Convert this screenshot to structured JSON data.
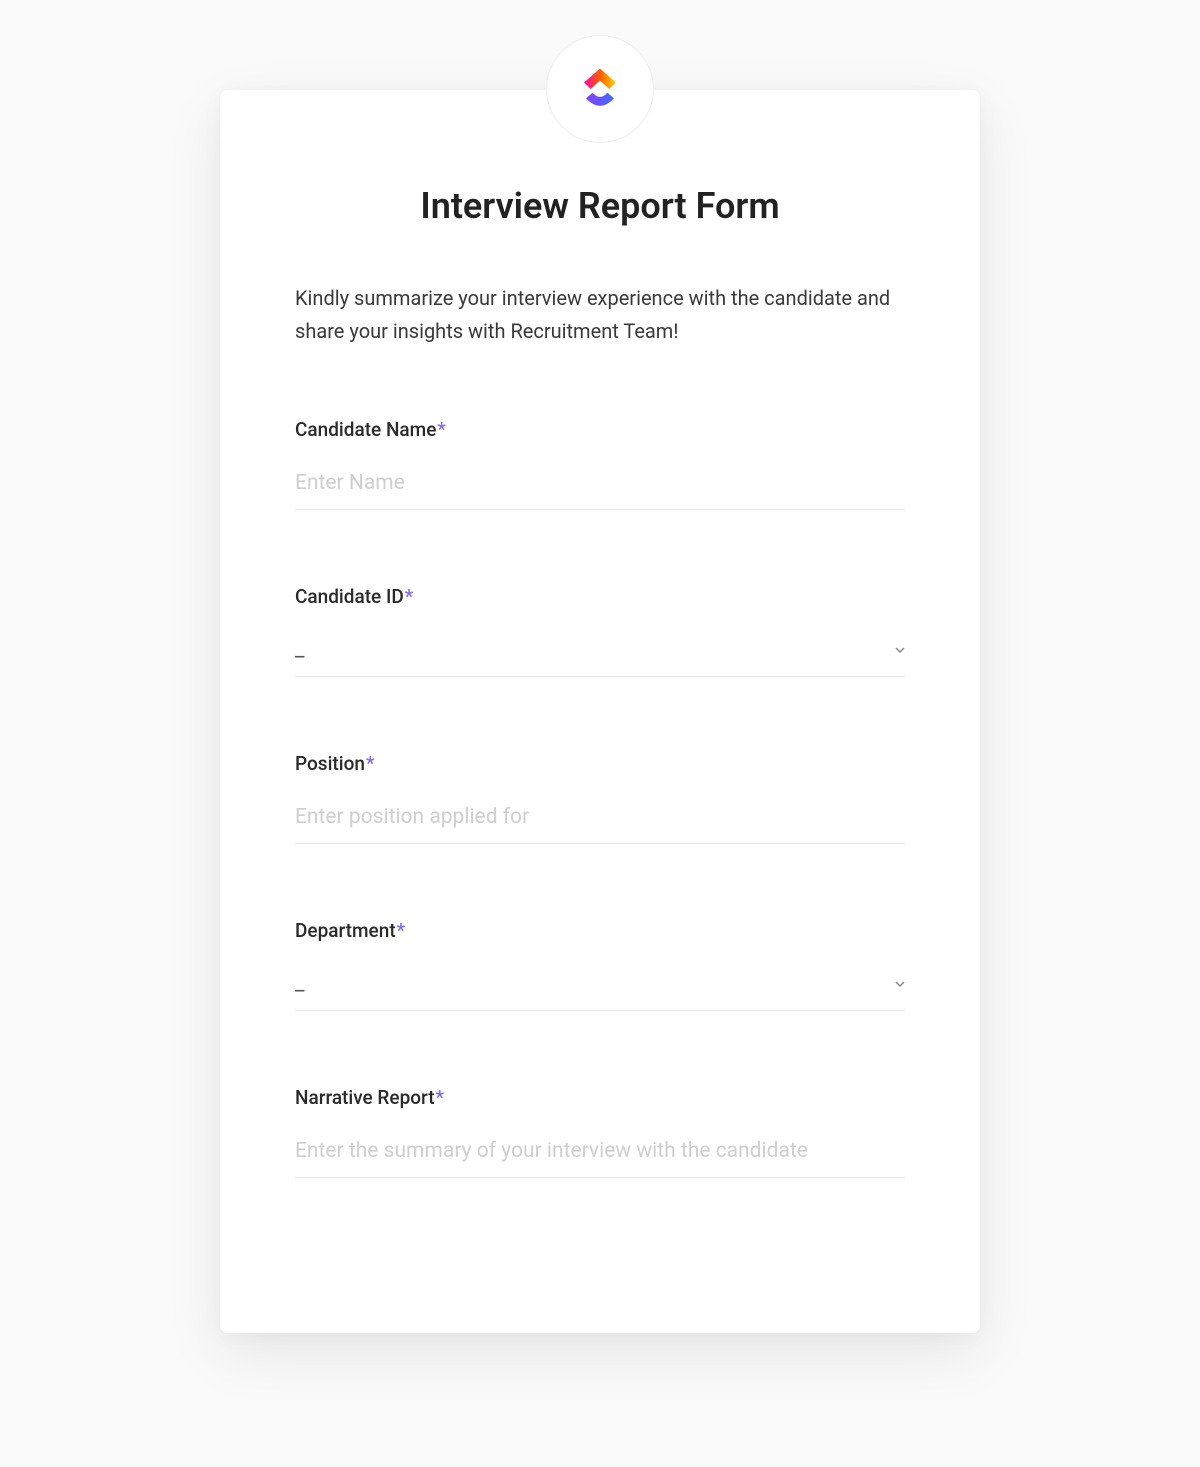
{
  "form": {
    "title": "Interview Report Form",
    "description": "Kindly summarize your interview experience with the candidate and share your insights with Recruitment Team!",
    "fields": {
      "candidate_name": {
        "label": "Candidate Name",
        "placeholder": "Enter Name",
        "required": true
      },
      "candidate_id": {
        "label": "Candidate ID",
        "value": "_",
        "required": true
      },
      "position": {
        "label": "Position",
        "placeholder": "Enter position applied for",
        "required": true
      },
      "department": {
        "label": "Department",
        "value": "_",
        "required": true
      },
      "narrative_report": {
        "label": "Narrative Report",
        "placeholder": "Enter the summary of your interview with the candidate",
        "required": true
      }
    },
    "required_marker": "*"
  }
}
